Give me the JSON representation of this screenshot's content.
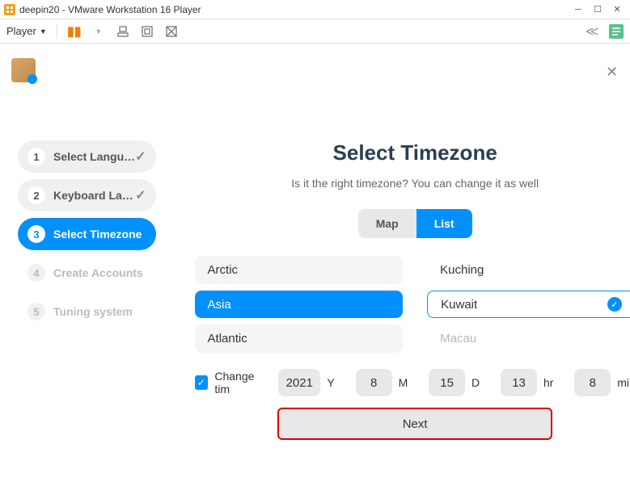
{
  "window": {
    "title": "deepin20 - VMware Workstation 16 Player"
  },
  "toolbar": {
    "player_label": "Player"
  },
  "sidebar": {
    "steps": [
      {
        "num": "1",
        "label": "Select Langu…",
        "state": "completed"
      },
      {
        "num": "2",
        "label": "Keyboard La…",
        "state": "completed"
      },
      {
        "num": "3",
        "label": "Select Timezone",
        "state": "active"
      },
      {
        "num": "4",
        "label": "Create Accounts",
        "state": "upcoming"
      },
      {
        "num": "5",
        "label": "Tuning system",
        "state": "upcoming"
      }
    ]
  },
  "main": {
    "title": "Select Timezone",
    "subtitle": "Is it the right timezone? You can change it as well",
    "toggle": {
      "map": "Map",
      "list": "List"
    },
    "regions": [
      "Arctic",
      "Asia",
      "Atlantic"
    ],
    "selected_region_index": 1,
    "cities": [
      "Kuching",
      "Kuwait",
      "Macau"
    ],
    "selected_city_index": 1,
    "change_time_label": "Change tim",
    "time": {
      "year": "2021",
      "month": "8",
      "day": "15",
      "hour": "13",
      "minute": "8"
    },
    "units": {
      "year": "Y",
      "month": "M",
      "day": "D",
      "hour": "hr",
      "minute": "min"
    },
    "next_label": "Next"
  }
}
